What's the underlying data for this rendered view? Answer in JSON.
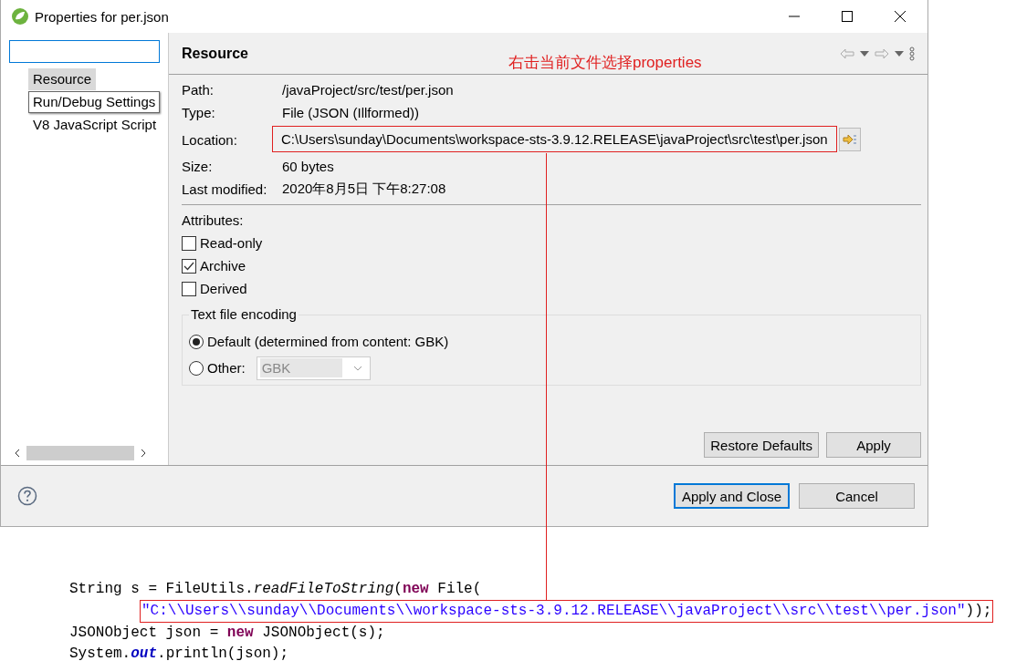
{
  "window": {
    "title": "Properties for per.json"
  },
  "sidebar": {
    "items": [
      {
        "label": "Resource",
        "selected": true,
        "hovered": false
      },
      {
        "label": "Run/Debug Settings",
        "selected": false,
        "hovered": true
      },
      {
        "label": "V8 JavaScript Script",
        "selected": false,
        "hovered": false
      }
    ]
  },
  "page": {
    "title": "Resource",
    "properties": [
      {
        "label": "Path:",
        "value": "/javaProject/src/test/per.json",
        "kind": "text"
      },
      {
        "label": "Type:",
        "value": "File  (JSON (Illformed))",
        "kind": "text"
      },
      {
        "label": "Location:",
        "value": "C:\\Users\\sunday\\Documents\\workspace-sts-3.9.12.RELEASE\\javaProject\\src\\test\\per.json",
        "kind": "location"
      },
      {
        "label": "Size:",
        "value": "60  bytes",
        "kind": "text"
      },
      {
        "label": "Last modified:",
        "value": "2020年8月5日 下午8:27:08",
        "kind": "text"
      }
    ],
    "attributes_label": "Attributes:",
    "attributes": [
      {
        "label": "Read-only",
        "checked": false
      },
      {
        "label": "Archive",
        "checked": true
      },
      {
        "label": "Derived",
        "checked": false
      }
    ],
    "encoding": {
      "title": "Text file encoding",
      "options": [
        {
          "label": "Default (determined from content: GBK)",
          "selected": true
        },
        {
          "label": "Other:",
          "selected": false
        }
      ],
      "dropdown": {
        "value": "GBK",
        "disabled": true
      }
    },
    "buttons": [
      {
        "label": "Restore Defaults"
      },
      {
        "label": "Apply"
      }
    ]
  },
  "footer": {
    "buttons": [
      {
        "label": "Apply and Close",
        "default": true
      },
      {
        "label": "Cancel",
        "default": false
      }
    ]
  },
  "annotation": {
    "text": "右击当前文件选择properties"
  },
  "code": [
    {
      "continuation": false,
      "highlighted": false,
      "tokens": [
        {
          "text": "String s = FileUtils.",
          "kind": "plain"
        },
        {
          "text": "readFileToString",
          "kind": "method"
        },
        {
          "text": "(",
          "kind": "plain"
        },
        {
          "text": "new",
          "kind": "keyword"
        },
        {
          "text": " File(",
          "kind": "plain"
        }
      ]
    },
    {
      "continuation": true,
      "highlighted": true,
      "tokens": [
        {
          "text": "\"C:\\\\Users\\\\sunday\\\\Documents\\\\workspace-sts-3.9.12.RELEASE\\\\javaProject\\\\src\\\\test\\\\per.json\"",
          "kind": "string"
        },
        {
          "text": "));",
          "kind": "plain"
        }
      ]
    },
    {
      "continuation": false,
      "highlighted": false,
      "tokens": [
        {
          "text": "JSONObject json = ",
          "kind": "plain"
        },
        {
          "text": "new",
          "kind": "keyword"
        },
        {
          "text": " JSONObject(s);",
          "kind": "plain"
        }
      ]
    },
    {
      "continuation": false,
      "highlighted": false,
      "tokens": [
        {
          "text": "System.",
          "kind": "plain"
        },
        {
          "text": "out",
          "kind": "field"
        },
        {
          "text": ".println(json);",
          "kind": "plain"
        }
      ]
    }
  ]
}
